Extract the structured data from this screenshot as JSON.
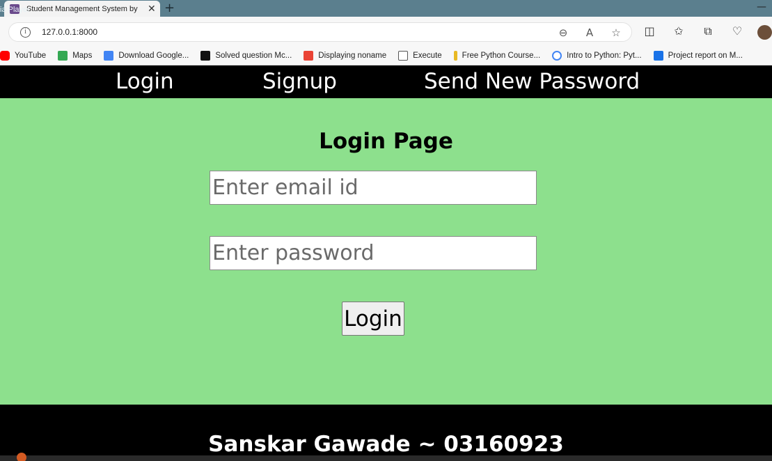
{
  "browser": {
    "overlay_text": "ia Player",
    "tab_title": "Student Management System by",
    "tab_close": "✕",
    "new_tab": "+",
    "window_minimize": "—",
    "url": "127.0.0.1:8000",
    "bookmarks": [
      {
        "label": "YouTube",
        "icon": "youtube-icon",
        "color": "#ff0000"
      },
      {
        "label": "Maps",
        "icon": "maps-icon",
        "color": "#34a853"
      },
      {
        "label": "Download Google...",
        "icon": "google-download-icon",
        "color": "#4285f4"
      },
      {
        "label": "Solved question Mc...",
        "icon": "site-icon",
        "color": "#111111"
      },
      {
        "label": "Displaying noname",
        "icon": "gmail-icon",
        "color": "#ea4335"
      },
      {
        "label": "Execute",
        "icon": "page-icon",
        "color": "#ffffff"
      },
      {
        "label": "Free Python Course...",
        "icon": "python-icon",
        "color": "#e8b923"
      },
      {
        "label": "Intro to Python: Pyt...",
        "icon": "google-icon",
        "color": "#4285f4"
      },
      {
        "label": "Project report on M...",
        "icon": "bookmark-icon",
        "color": "#1a73e8"
      }
    ]
  },
  "nav": {
    "login": "Login",
    "signup": "Signup",
    "send_new_password": "Send New Password"
  },
  "login": {
    "title": "Login Page",
    "email_placeholder": "Enter email id",
    "password_placeholder": "Enter password",
    "button": "Login"
  },
  "footer": {
    "text": "Sanskar Gawade ~ 03160923"
  },
  "colors": {
    "page_background": "#8de08d",
    "nav_background": "#000000",
    "tab_strip": "#5b7f8e"
  }
}
